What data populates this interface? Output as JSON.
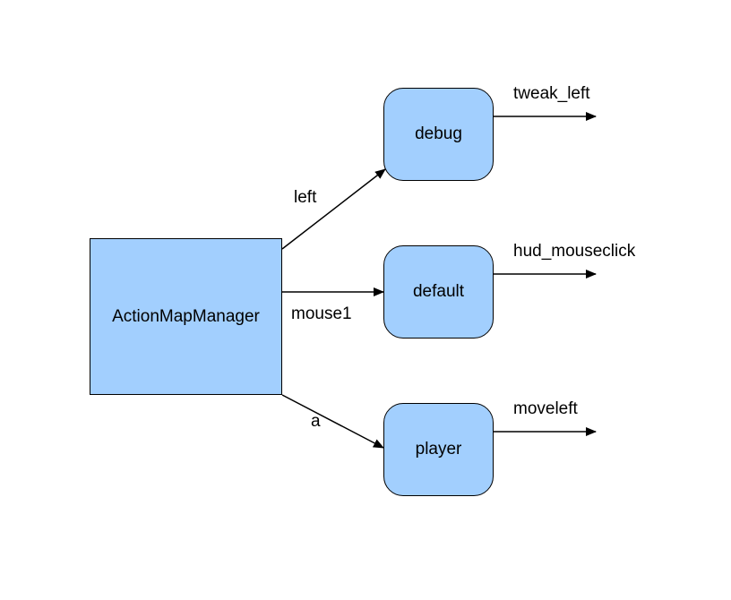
{
  "nodes": {
    "manager": {
      "label": "ActionMapManager"
    },
    "debug": {
      "label": "debug"
    },
    "default": {
      "label": "default"
    },
    "player": {
      "label": "player"
    }
  },
  "edges": {
    "to_debug": {
      "label": "left"
    },
    "to_default": {
      "label": "mouse1"
    },
    "to_player": {
      "label": "a"
    }
  },
  "outputs": {
    "debug": {
      "label": "tweak_left"
    },
    "default": {
      "label": "hud_mouseclick"
    },
    "player": {
      "label": "moveleft"
    }
  },
  "colors": {
    "node_fill": "#a2cffe",
    "stroke": "#000000",
    "background": "#ffffff"
  }
}
